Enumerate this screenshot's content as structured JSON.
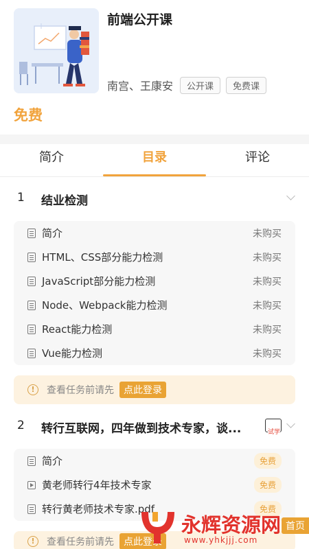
{
  "course": {
    "title": "前端公开课",
    "teachers": "南宫、王康安",
    "tags": [
      "公开课",
      "免费课"
    ],
    "price": "免费"
  },
  "tabs": [
    {
      "label": "简介",
      "active": false
    },
    {
      "label": "目录",
      "active": true
    },
    {
      "label": "评论",
      "active": false
    }
  ],
  "chapters": [
    {
      "number": "1",
      "title": "结业检测",
      "lessons": [
        {
          "label": "简介",
          "status": "未购买",
          "icon": "document-icon"
        },
        {
          "label": "HTML、CSS部分能力检测",
          "status": "未购买",
          "icon": "document-icon"
        },
        {
          "label": "JavaScript部分能力检测",
          "status": "未购买",
          "icon": "document-icon"
        },
        {
          "label": "Node、Webpack能力检测",
          "status": "未购买",
          "icon": "document-icon"
        },
        {
          "label": "React能力检测",
          "status": "未购买",
          "icon": "document-icon"
        },
        {
          "label": "Vue能力检测",
          "status": "未购买",
          "icon": "document-icon"
        }
      ]
    },
    {
      "number": "2",
      "title": "转行互联网，四年做到技术专家，谈...",
      "trial_label": "试学",
      "lessons": [
        {
          "label": "简介",
          "status": "免费",
          "icon": "document-icon"
        },
        {
          "label": "黄老师转行4年技术专家",
          "status": "免费",
          "icon": "video-icon"
        },
        {
          "label": "转行黄老师技术专家.pdf",
          "status": "免费",
          "icon": "document-icon"
        }
      ]
    }
  ],
  "login_prompt": {
    "hint": "查看任务前请先",
    "button": "点此登录"
  },
  "watermark": {
    "title": "永辉资源网",
    "url": "www.yhkjjj.com",
    "home": "首页"
  },
  "colors": {
    "accent": "#f1a33c",
    "watermark_red": "#e2332d"
  }
}
